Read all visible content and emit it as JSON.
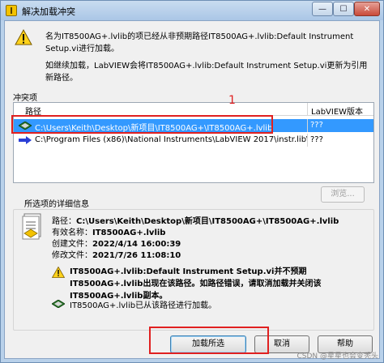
{
  "window": {
    "title": "解决加载冲突",
    "controls": {
      "minimize": "—",
      "maximize": "☐",
      "close": "✕"
    }
  },
  "message": {
    "line1": "名为IT8500AG+.lvlib的项已经从非预期路径IT8500AG+.lvlib:Default Instrument Setup.vi进行加载。",
    "line2": "如继续加载，LabVIEW会将IT8500AG+.lvlib:Default Instrument Setup.vi更新为引用新路径。"
  },
  "conflict": {
    "label": "冲突项",
    "columns": {
      "path": "路径",
      "version": "LabVIEW版本"
    },
    "rows": [
      {
        "path": "C:\\Users\\Keith\\Desktop\\新项目\\IT8500AG+\\IT8500AG+.lvlib",
        "version": "???",
        "icon": "library-icon"
      },
      {
        "path": "C:\\Program Files (x86)\\National Instruments\\LabVIEW 2017\\instr.lib\\IT8500",
        "version": "???",
        "icon": "arrow-icon"
      }
    ],
    "annotation": "1",
    "browse_label": "浏览..."
  },
  "details": {
    "title": "所选项的详细信息",
    "path_label": "路径：",
    "path_value": "C:\\Users\\Keith\\Desktop\\新项目\\IT8500AG+\\IT8500AG+.lvlib",
    "name_label": "有效名称：",
    "name_value": "IT8500AG+.lvlib",
    "created_label": "创建文件：",
    "created_value": "2022/4/14 16:00:39",
    "modified_label": "修改文件：",
    "modified_value": "2021/7/26 11:08:10",
    "warning": "IT8500AG+.lvlib:Default Instrument Setup.vi并不预期IT8500AG+.lvlib出现在该路径。如路径错误，请取消加载并关闭该IT8500AG+.lvlib副本。",
    "load_note": "IT8500AG+.lvlib已从该路径进行加载。"
  },
  "buttons": {
    "load": "加载所选",
    "cancel": "取消",
    "help": "帮助"
  },
  "watermark": "CSDN @星星也会变秃头",
  "colors": {
    "selection": "#3399ff",
    "annotation_red": "#e02020",
    "window_frame": "#b9d1ea"
  }
}
